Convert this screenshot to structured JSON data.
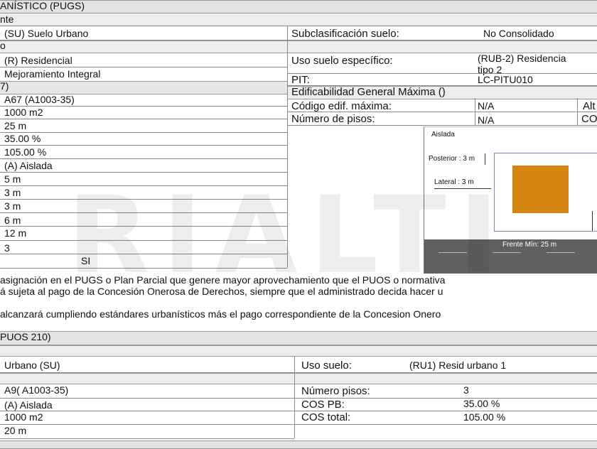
{
  "pugs": {
    "section_title": "ANÍSTICO (PUGS)",
    "sub_title": "nte",
    "clasificacion": "(SU) Suelo Urbano",
    "subclasificacion_label": "Subclasificación suelo:",
    "subclasificacion_value": "No Consolidado",
    "band2": "o",
    "uso_general": "(R) Residencial",
    "uso_especifico_label": "Uso suelo específico:",
    "uso_especifico_value_1": "(RUB-2) Residencia",
    "uso_especifico_value_2": "tipo 2",
    "tratamiento": "Mejoramiento Integral",
    "pit_label": "PIT:",
    "pit_value": "LC-PITU010",
    "band3": "7)",
    "edificabilidad_title": "Edificabilidad General Máxima ()",
    "codigo_edif_label": "Código edif. máxima:",
    "codigo_edif_value": "N/A",
    "codigo_edif_extra": "Alt",
    "num_pisos_label": "Número de pisos:",
    "num_pisos_value": "N/A",
    "num_pisos_extra": "CO",
    "rows": [
      "A67 (A1003-35)",
      "1000 m2",
      "25 m",
      "35.00 %",
      "105.00 %",
      "(A) Aislada",
      "5 m",
      "3 m",
      "3 m",
      "6 m",
      "12 m",
      "3",
      "SI"
    ]
  },
  "diagram": {
    "title": "Aislada",
    "posterior": "Posterior : 3 m",
    "lateral": "Lateral : 3 m",
    "frente": "Frente Mín: 25 m",
    "building_color": "#d68412",
    "street_color": "#606060"
  },
  "notes": {
    "line1": "asignación en el PUGS o Plan Parcial que genere mayor aprovechamiento que el PUOS o normativa",
    "line2": "á sujeta al pago de la Concesión Onerosa de Derechos, siempre que el administrado decida hacer u",
    "line3": "alcanzará cumpliendo estándares urbanísticos más el pago correspondiente de la Concesion Onero"
  },
  "puos": {
    "section_title": "PUOS 210)",
    "clasificacion": "Urbano (SU)",
    "uso_label": "Uso suelo:",
    "uso_value": "(RU1) Resid urbano 1",
    "zona": "A9( A1003-35)",
    "forma": "(A) Aislada",
    "lote": "1000 m2",
    "frente": "20 m",
    "num_pisos_label": "Número pisos:",
    "num_pisos_value": "3",
    "cos_pb_label": "COS PB:",
    "cos_pb_value": "35.00 %",
    "cos_total_label": "COS total:",
    "cos_total_value": "105.00 %"
  },
  "watermark": "RIALTI"
}
